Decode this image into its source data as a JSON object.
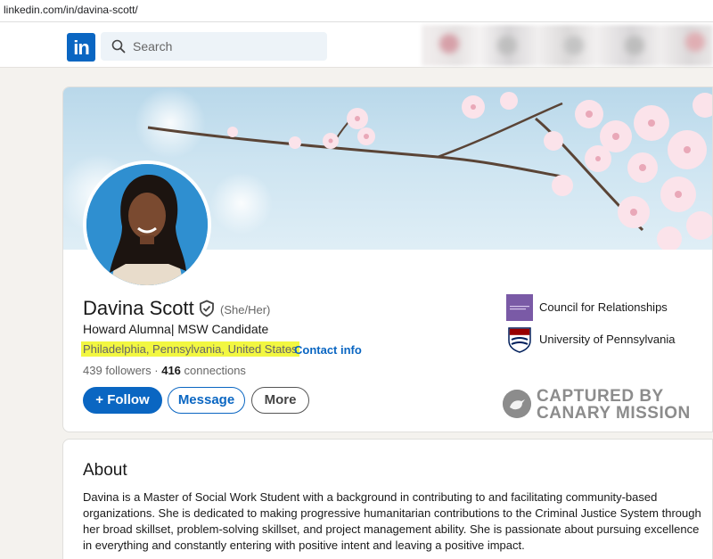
{
  "browser": {
    "url": "linkedin.com/in/davina-scott/"
  },
  "nav": {
    "logo_text": "in",
    "search_placeholder": "Search"
  },
  "profile": {
    "name": "Davina Scott",
    "pronouns": "(She/Her)",
    "headline": "Howard Alumna| MSW Candidate",
    "location": "Philadelphia, Pennsylvania, United States",
    "separator": "·",
    "contact_label": "Contact info",
    "followers_count": "439",
    "followers_label": "followers",
    "connections_count": "416",
    "connections_label": "connections",
    "stats_separator": "·"
  },
  "actions": {
    "follow": "+ Follow",
    "message": "Message",
    "more": "More"
  },
  "orgs": [
    {
      "name": "Council for Relationships",
      "logo_text": "COUNCIL FOR RELATIONSHIPS",
      "icon": "council-logo"
    },
    {
      "name": "University of Pennsylvania",
      "icon": "penn-shield-logo"
    }
  ],
  "watermark": {
    "line1": "CAPTURED BY",
    "line2": "CANARY MISSION"
  },
  "about": {
    "title": "About",
    "text": "Davina is a Master of Social Work Student with a background in contributing to and facilitating community-based organizations. She is dedicated to making progressive humanitarian contributions to the Criminal Justice System through her broad skillset, problem-solving skillset, and project management ability. She is passionate about pursuing excellence in everything and constantly entering with positive intent and leaving a positive impact."
  },
  "colors": {
    "brand": "#0a66c2",
    "highlight": "#f2f741",
    "council": "#7a5aa6",
    "penn_red": "#990000",
    "penn_blue": "#011f5b"
  }
}
